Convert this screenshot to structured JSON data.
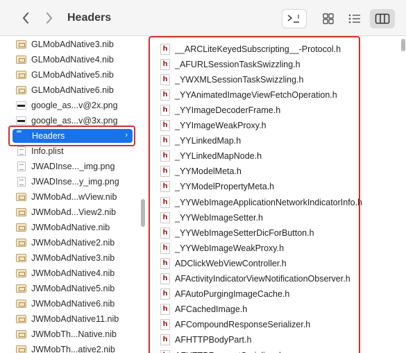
{
  "toolbar": {
    "title": "Headers",
    "icons": [
      "chevron-left-icon",
      "chevron-right-icon",
      "terminal-icon",
      "grid-view-icon",
      "list-view-icon",
      "column-view-icon"
    ]
  },
  "left_column": {
    "items": [
      {
        "label": "GLMobAdNative3.nib",
        "type": "nib"
      },
      {
        "label": "GLMobAdNative4.nib",
        "type": "nib"
      },
      {
        "label": "GLMobAdNative5.nib",
        "type": "nib"
      },
      {
        "label": "GLMobAdNative6.nib",
        "type": "nib"
      },
      {
        "label": "google_as...v@2x.png",
        "type": "png"
      },
      {
        "label": "google_as...v@3x.png",
        "type": "png"
      },
      {
        "label": "Headers",
        "type": "folder",
        "selected": true
      },
      {
        "label": "Info.plist",
        "type": "plist"
      },
      {
        "label": "JWADInse..._img.png",
        "type": "plist"
      },
      {
        "label": "JWADInse...y_img.png",
        "type": "plist"
      },
      {
        "label": "JWMobAd...wView.nib",
        "type": "nib"
      },
      {
        "label": "JWMobAd...View2.nib",
        "type": "nib"
      },
      {
        "label": "JWMobAdNative.nib",
        "type": "nib"
      },
      {
        "label": "JWMobAdNative2.nib",
        "type": "nib"
      },
      {
        "label": "JWMobAdNative3.nib",
        "type": "nib"
      },
      {
        "label": "JWMobAdNative4.nib",
        "type": "nib"
      },
      {
        "label": "JWMobAdNative5.nib",
        "type": "nib"
      },
      {
        "label": "JWMobAdNative6.nib",
        "type": "nib"
      },
      {
        "label": "JWMobAdNative11.nib",
        "type": "nib"
      },
      {
        "label": "JWMobTh...Native.nib",
        "type": "nib"
      },
      {
        "label": "JWMobTh...ative2.nib",
        "type": "nib"
      }
    ]
  },
  "right_column": {
    "icon_letter": "h",
    "items": [
      "__ARCLiteKeyedSubscripting__-Protocol.h",
      "_AFURLSessionTaskSwizzling.h",
      "_YWXMLSessionTaskSwizzling.h",
      "_YYAnimatedImageViewFetchOperation.h",
      "_YYImageDecoderFrame.h",
      "_YYImageWeakProxy.h",
      "_YYLinkedMap.h",
      "_YYLinkedMapNode.h",
      "_YYModelMeta.h",
      "_YYModelPropertyMeta.h",
      "_YYWebImageApplicationNetworkIndicatorInfo.h",
      "_YYWebImageSetter.h",
      "_YYWebImageSetterDicForButton.h",
      "_YYWebImageWeakProxy.h",
      "ADClickWebViewController.h",
      "AFActivityIndicatorViewNotificationObserver.h",
      "AFAutoPurgingImageCache.h",
      "AFCachedImage.h",
      "AFCompoundResponseSerializer.h",
      "AFHTTPBodyPart.h",
      "AFHTTPRequestSerializer.h"
    ]
  },
  "colors": {
    "selection": "#1a72e8",
    "highlight_outline": "#d62b2b",
    "folder": "#4a9ff0"
  }
}
